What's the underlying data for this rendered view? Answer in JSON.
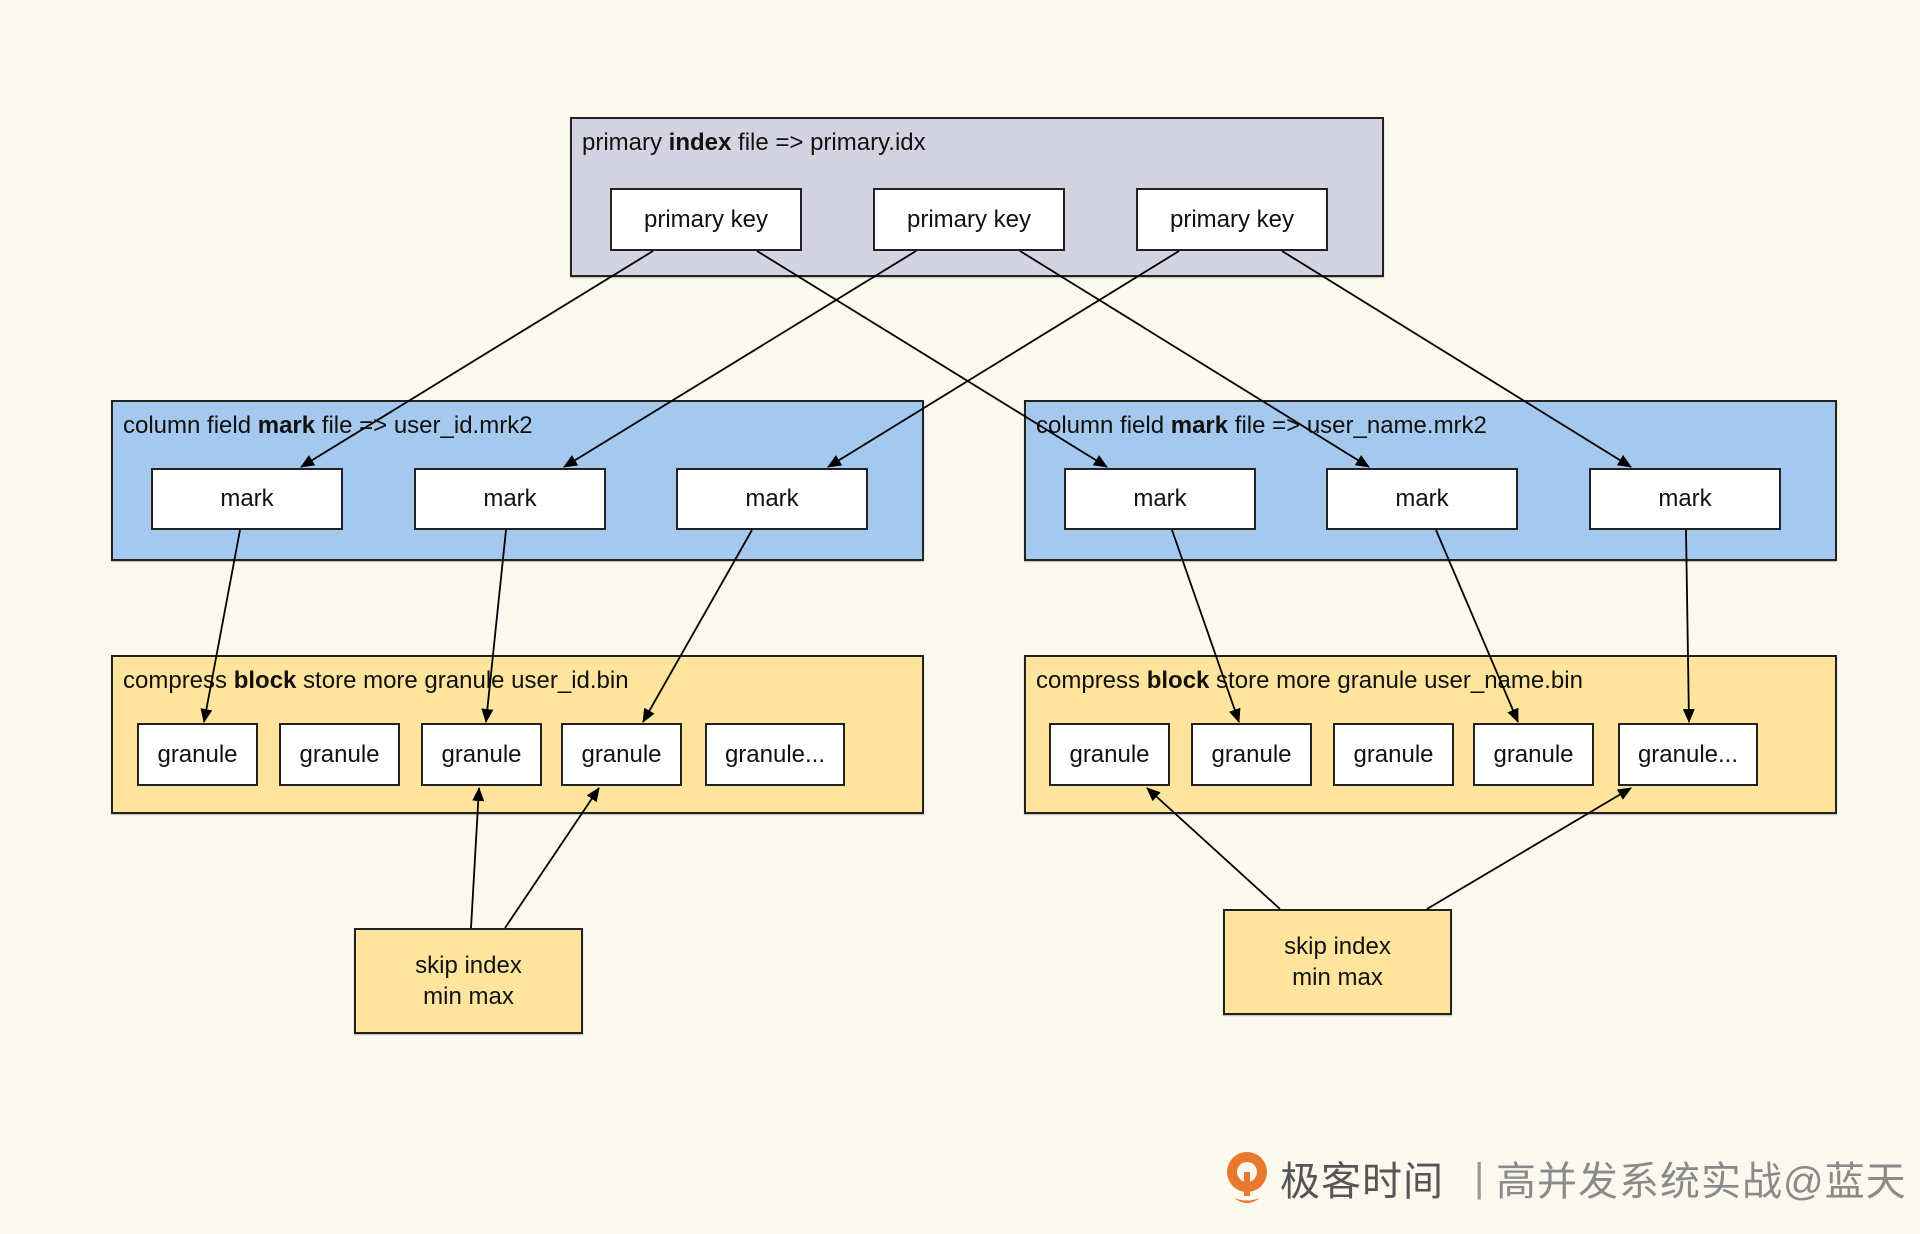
{
  "primary_index": {
    "title_pre": "primary ",
    "title_bold": "index",
    "title_post": " file => primary.idx",
    "keys": [
      "primary key",
      "primary key",
      "primary key"
    ]
  },
  "mark_files": [
    {
      "title_pre": "column field ",
      "title_bold": "mark",
      "title_post": " file => user_id.mrk2",
      "marks": [
        "mark",
        "mark",
        "mark"
      ]
    },
    {
      "title_pre": "column field ",
      "title_bold": "mark",
      "title_post": " file => user_name.mrk2",
      "marks": [
        "mark",
        "mark",
        "mark"
      ]
    }
  ],
  "bin_files": [
    {
      "title_pre": "compress ",
      "title_bold": "block",
      "title_post": " store more granule user_id.bin",
      "granules": [
        "granule",
        "granule",
        "granule",
        "granule",
        "granule..."
      ]
    },
    {
      "title_pre": "compress ",
      "title_bold": "block",
      "title_post": " store more granule user_name.bin",
      "granules": [
        "granule",
        "granule",
        "granule",
        "granule",
        "granule..."
      ]
    }
  ],
  "skip_indexes": [
    {
      "line1": "skip index",
      "line2": "min max"
    },
    {
      "line1": "skip index",
      "line2": "min max"
    }
  ],
  "edges": [
    {
      "from": "primary_key_1",
      "to": "user_id_mark_1"
    },
    {
      "from": "primary_key_1",
      "to": "user_name_mark_1"
    },
    {
      "from": "primary_key_2",
      "to": "user_id_mark_2"
    },
    {
      "from": "primary_key_2",
      "to": "user_name_mark_2"
    },
    {
      "from": "primary_key_3",
      "to": "user_id_mark_3"
    },
    {
      "from": "primary_key_3",
      "to": "user_name_mark_3"
    },
    {
      "from": "user_id_mark_1",
      "to": "user_id_granule_1"
    },
    {
      "from": "user_id_mark_2",
      "to": "user_id_granule_3"
    },
    {
      "from": "user_id_mark_3",
      "to": "user_id_granule_4"
    },
    {
      "from": "user_name_mark_1",
      "to": "user_name_granule_2"
    },
    {
      "from": "user_name_mark_2",
      "to": "user_name_granule_4"
    },
    {
      "from": "user_name_mark_3",
      "to": "user_name_granule_5"
    },
    {
      "from": "skip_index_1",
      "to": "user_id_granule_3"
    },
    {
      "from": "skip_index_1",
      "to": "user_id_granule_4"
    },
    {
      "from": "skip_index_2",
      "to": "user_name_granule_1"
    },
    {
      "from": "skip_index_2",
      "to": "user_name_granule_5"
    }
  ],
  "colors": {
    "background": "#FBF8EE",
    "primary_panel": "#D3D3E2",
    "mark_panel": "#A4C8EE",
    "bin_panel": "#FEE49C",
    "logo_orange": "#E8782E"
  },
  "watermark": {
    "brand": "极客时间",
    "separator": "|",
    "course": "高并发系统实战@蓝天",
    "logo_icon": "geektime-logo-icon"
  }
}
